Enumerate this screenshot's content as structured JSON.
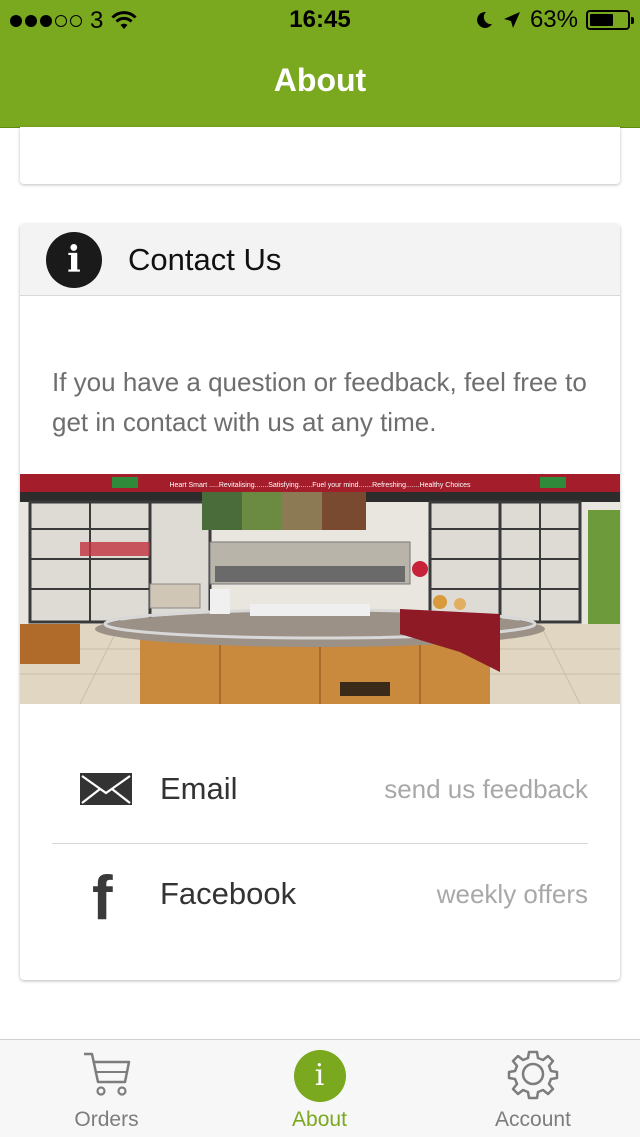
{
  "status_bar": {
    "carrier": "3",
    "signal_full": 3,
    "signal_total": 5,
    "time": "16:45",
    "battery": "63%",
    "battery_level": 0.63
  },
  "header": {
    "title": "About"
  },
  "contact": {
    "title": "Contact Us",
    "intro": "If you have a question or feedback, feel free to get in contact with us at any time."
  },
  "photo": {
    "banner_text": "Heart Smart .....Revitalising.......Satisfying.......Fuel your mind.......Refreshing.......Healthy Choices"
  },
  "rows": {
    "email_label": "Email",
    "email_hint": "send us feedback",
    "facebook_label": "Facebook",
    "facebook_hint": "weekly offers"
  },
  "tabs": {
    "orders": "Orders",
    "about": "About",
    "about_icon_letter": "i",
    "account": "Account"
  },
  "colors": {
    "accent": "#7aa81f",
    "tab_inactive": "#7d7d7d"
  }
}
